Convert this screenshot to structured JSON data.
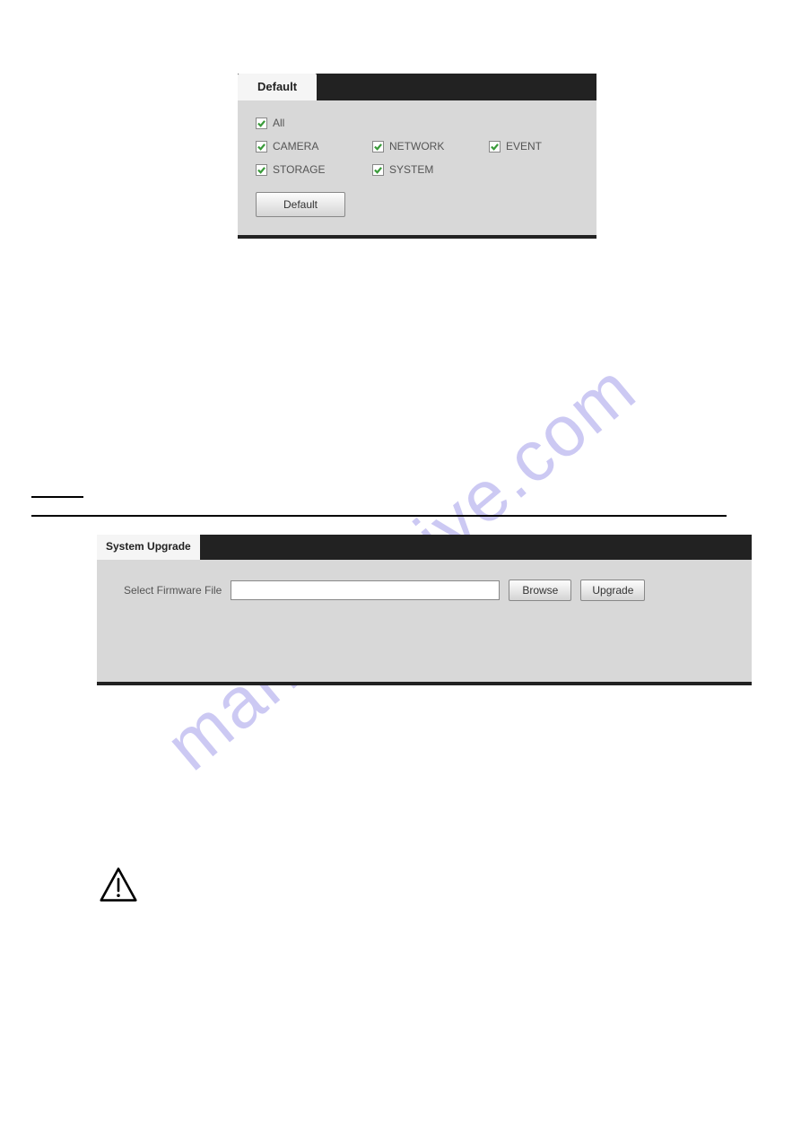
{
  "watermark": "manualshive.com",
  "default_panel": {
    "tab_label": "Default",
    "checkboxes": {
      "all": "All",
      "camera": "CAMERA",
      "network": "NETWORK",
      "event": "EVENT",
      "storage": "STORAGE",
      "system": "SYSTEM"
    },
    "button_label": "Default"
  },
  "upgrade_panel": {
    "tab_label": "System Upgrade",
    "field_label": "Select Firmware File",
    "browse_label": "Browse",
    "upgrade_label": "Upgrade"
  }
}
